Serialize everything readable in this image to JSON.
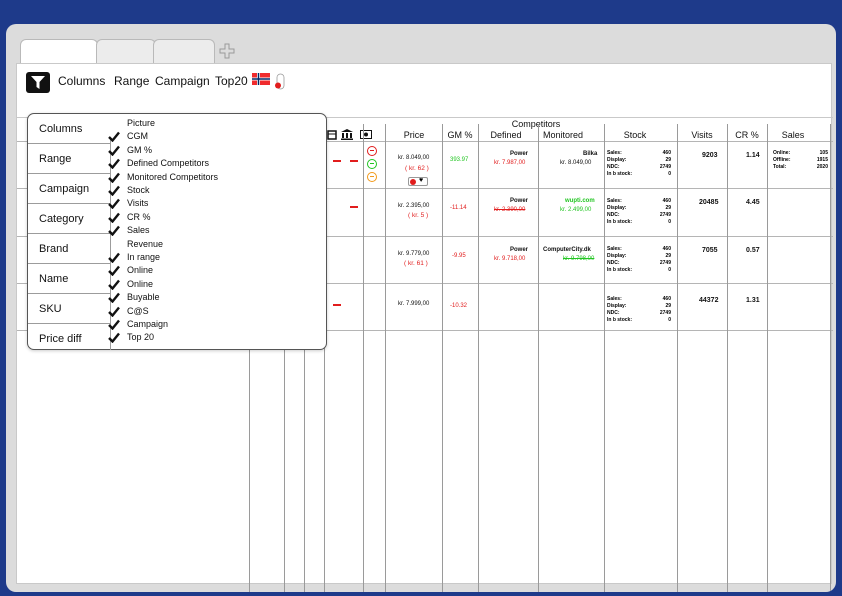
{
  "toolbar": {
    "columns": "Columns",
    "range": "Range",
    "campaign": "Campaign",
    "top20": "Top20"
  },
  "headers": {
    "price": "Price",
    "gm": "GM %",
    "competitors": "Competitors",
    "defined": "Defined",
    "monitored": "Monitored",
    "stock": "Stock",
    "visits": "Visits",
    "cr": "CR %",
    "sales": "Sales"
  },
  "stock_labels": {
    "sales": "Sales:",
    "display": "Display:",
    "ndc": "NDC:",
    "instock": "In b stock:"
  },
  "rows": [
    {
      "price": "kr. 8.049,00",
      "price_sub": "( kr. 62 )",
      "gm": "393.97",
      "def_name": "Power",
      "def_price": "kr. 7.987,00",
      "mon_name": "Bilka",
      "mon_price": "kr. 8.049,00",
      "stock": {
        "sales": "460",
        "display": "29",
        "ndc": "2749",
        "instock": "0"
      },
      "visits": "9203",
      "cr": "1.14",
      "sales": {
        "online_label": "Online:",
        "online": "105",
        "offline_label": "Offline:",
        "offline": "1915",
        "total_label": "Total:",
        "total": "2020"
      }
    },
    {
      "price": "kr. 2.395,00",
      "price_sub": "( kr. 5 )",
      "gm": "-11.14",
      "def_name": "Power",
      "def_price": "kr. 2.390,00",
      "mon_name": "wupti.com",
      "mon_price": "kr. 2.499,00",
      "stock": {
        "sales": "460",
        "display": "29",
        "ndc": "2749",
        "instock": "0"
      },
      "visits": "20485",
      "cr": "4.45"
    },
    {
      "price": "kr. 9.779,00",
      "price_sub": "( kr. 61 )",
      "gm": "-9.95",
      "def_name": "Power",
      "def_price": "kr. 9.718,00",
      "mon_name": "ComputerCity.dk",
      "mon_price": "kr. 9.798,00",
      "stock": {
        "sales": "460",
        "display": "29",
        "ndc": "2749",
        "instock": "0"
      },
      "visits": "7055",
      "cr": "0.57"
    },
    {
      "price": "kr. 7.999,00",
      "gm": "-10.32",
      "stock": {
        "sales": "460",
        "display": "29",
        "ndc": "2749",
        "instock": "0"
      },
      "visits": "44372",
      "cr": "1.31"
    }
  ],
  "dropdown": {
    "left_items": [
      "Columns",
      "Range",
      "Campaign",
      "Category",
      "Brand",
      "Name",
      "SKU",
      "Price diff"
    ],
    "options": [
      {
        "label": "Picture",
        "checked": false
      },
      {
        "label": "CGM",
        "checked": true
      },
      {
        "label": "GM %",
        "checked": true
      },
      {
        "label": "Defined Competitors",
        "checked": true
      },
      {
        "label": "Monitored Competitors",
        "checked": true
      },
      {
        "label": "Stock",
        "checked": true
      },
      {
        "label": "Visits",
        "checked": true
      },
      {
        "label": "CR %",
        "checked": true
      },
      {
        "label": "Sales",
        "checked": true
      },
      {
        "label": "Revenue",
        "checked": false
      },
      {
        "label": "In range",
        "checked": true
      },
      {
        "label": "Online",
        "checked": true
      },
      {
        "label": "Online",
        "checked": true
      },
      {
        "label": "Buyable",
        "checked": true
      },
      {
        "label": "C@S",
        "checked": true
      },
      {
        "label": "Campaign",
        "checked": true
      },
      {
        "label": "Top 20",
        "checked": true
      }
    ]
  },
  "colors": {
    "accent_red": "#e11d1d",
    "accent_green": "#21c521",
    "frame_blue": "#1e3a8a"
  }
}
